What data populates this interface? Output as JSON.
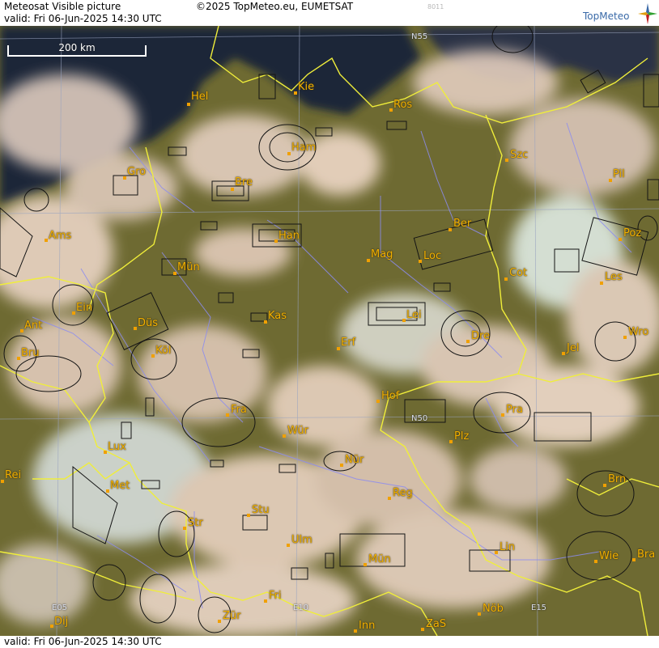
{
  "header": {
    "title": "Meteosat Visible picture",
    "copyright": "©2025 TopMeteo.eu, EUMETSAT",
    "image_id": "8011",
    "valid": "valid:  Fri  06-Jun-2025  14:30 UTC",
    "logo_text": "TopMeteo"
  },
  "footer": {
    "valid": "valid:  Fri  06-Jun-2025  14:30 UTC"
  },
  "scale_bar": {
    "label": "200 km"
  },
  "grid_labels": {
    "n55": "N55",
    "n50": "N50",
    "e05": "E05",
    "e10": "E10",
    "e15": "E15"
  },
  "cities": {
    "hel": "Hel",
    "kie": "Kie",
    "ros": "Ros",
    "ham": "Ham",
    "szc": "Szc",
    "gro": "Gro",
    "bre": "Bre",
    "pil": "Pil",
    "ber": "Ber",
    "ams": "Ams",
    "han": "Han",
    "poz": "Poz",
    "mag": "Mag",
    "loc": "Loc",
    "mun": "Mün",
    "cot": "Cot",
    "les": "Les",
    "ein": "Ein",
    "kas": "Kas",
    "lei": "Lei",
    "ant": "Ant",
    "dus": "Düs",
    "dre": "Dre",
    "wro": "Wro",
    "bru": "Bru",
    "kol": "Köl",
    "erf": "Erf",
    "jel": "Jel",
    "hof": "Hof",
    "fra": "Fra",
    "pra": "Pra",
    "wur": "Wür",
    "plz": "Plz",
    "lux": "Lux",
    "nur": "Nür",
    "rei": "Rei",
    "met": "Met",
    "reg": "Reg",
    "brn": "Brn",
    "stu": "Stu",
    "str": "Str",
    "ulm": "Ulm",
    "lin": "Lin",
    "mun2": "Mün",
    "wie": "Wie",
    "bra": "Bra",
    "fri": "Fri",
    "zur": "Zür",
    "nob": "Nöb",
    "dij": "Dij",
    "inn": "Inn",
    "zas": "ZaS"
  },
  "colors": {
    "border": "#f0ee3a",
    "river": "#8c8cf0",
    "city_dot": "#f0a000",
    "label": "#f2b000",
    "grid": "#9aa4c0",
    "airspace": "#141414",
    "land": "#6e6a32",
    "cloud": "#e6cdbb",
    "sea": "#1c2838"
  }
}
